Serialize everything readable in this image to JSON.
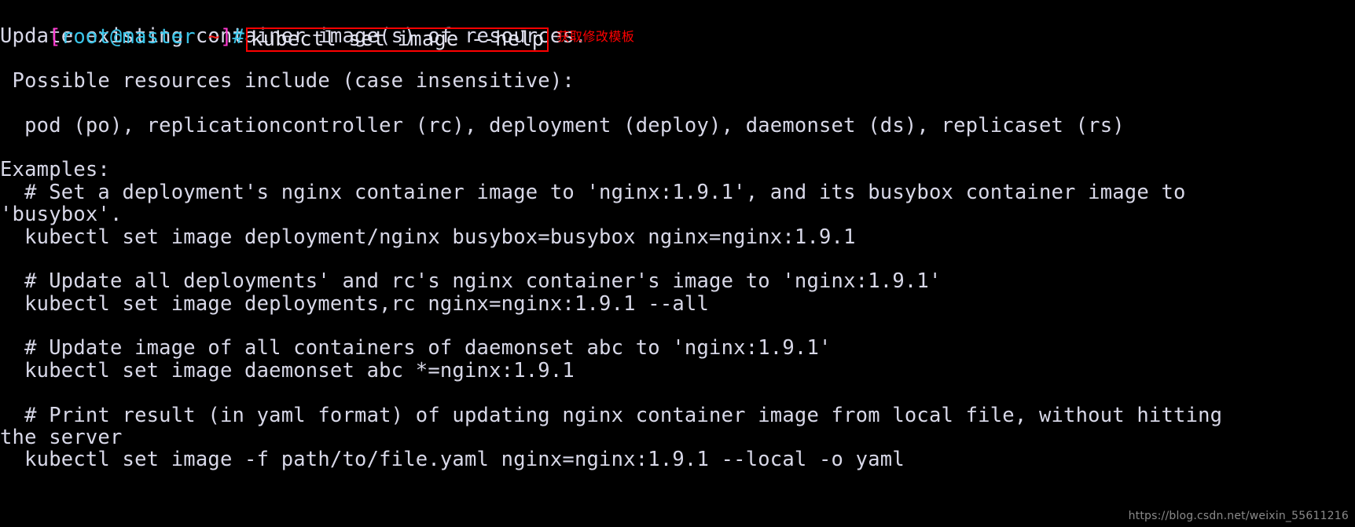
{
  "terminal": {
    "prompt": {
      "bracket_open": "[",
      "user_host": "root@master",
      "tilde": " ~",
      "bracket_close": "]",
      "hash": "#"
    },
    "command": "kubectl set image --help",
    "annotation": "获取修改模板",
    "watermark": "https://blog.csdn.net/weixin_55611216",
    "output_lines": [
      "Update existing container image(s) of resources.",
      "",
      " Possible resources include (case insensitive):",
      "",
      "  pod (po), replicationcontroller (rc), deployment (deploy), daemonset (ds), replicaset (rs)",
      "",
      "Examples:",
      "  # Set a deployment's nginx container image to 'nginx:1.9.1', and its busybox container image to",
      "'busybox'.",
      "  kubectl set image deployment/nginx busybox=busybox nginx=nginx:1.9.1",
      "",
      "  # Update all deployments' and rc's nginx container's image to 'nginx:1.9.1'",
      "  kubectl set image deployments,rc nginx=nginx:1.9.1 --all",
      "",
      "  # Update image of all containers of daemonset abc to 'nginx:1.9.1'",
      "  kubectl set image daemonset abc *=nginx:1.9.1",
      "",
      "  # Print result (in yaml format) of updating nginx container image from local file, without hitting",
      "the server",
      "  kubectl set image -f path/to/file.yaml nginx=nginx:1.9.1 --local -o yaml"
    ]
  },
  "colors": {
    "background": "#000000",
    "foreground": "#d8d8e8",
    "prompt_bracket": "#ff3ad0",
    "prompt_user": "#39c4e8",
    "prompt_tilde": "#ff2020",
    "highlight_box": "#ff0000",
    "annotation": "#ff0000",
    "watermark": "#8a8a8a"
  }
}
